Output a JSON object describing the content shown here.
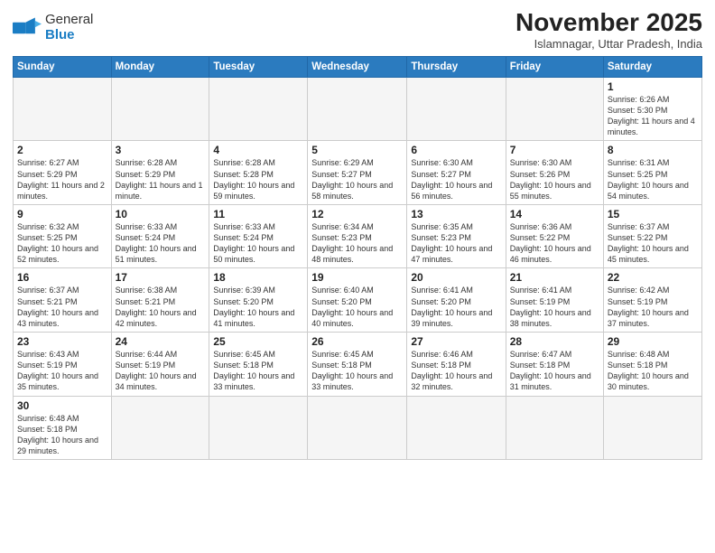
{
  "header": {
    "logo": {
      "general": "General",
      "blue": "Blue"
    },
    "month_year": "November 2025",
    "location": "Islamnagar, Uttar Pradesh, India"
  },
  "weekdays": [
    "Sunday",
    "Monday",
    "Tuesday",
    "Wednesday",
    "Thursday",
    "Friday",
    "Saturday"
  ],
  "weeks": [
    [
      {
        "day": "",
        "info": ""
      },
      {
        "day": "",
        "info": ""
      },
      {
        "day": "",
        "info": ""
      },
      {
        "day": "",
        "info": ""
      },
      {
        "day": "",
        "info": ""
      },
      {
        "day": "",
        "info": ""
      },
      {
        "day": "1",
        "info": "Sunrise: 6:26 AM\nSunset: 5:30 PM\nDaylight: 11 hours and 4 minutes."
      }
    ],
    [
      {
        "day": "2",
        "info": "Sunrise: 6:27 AM\nSunset: 5:29 PM\nDaylight: 11 hours and 2 minutes."
      },
      {
        "day": "3",
        "info": "Sunrise: 6:28 AM\nSunset: 5:29 PM\nDaylight: 11 hours and 1 minute."
      },
      {
        "day": "4",
        "info": "Sunrise: 6:28 AM\nSunset: 5:28 PM\nDaylight: 10 hours and 59 minutes."
      },
      {
        "day": "5",
        "info": "Sunrise: 6:29 AM\nSunset: 5:27 PM\nDaylight: 10 hours and 58 minutes."
      },
      {
        "day": "6",
        "info": "Sunrise: 6:30 AM\nSunset: 5:27 PM\nDaylight: 10 hours and 56 minutes."
      },
      {
        "day": "7",
        "info": "Sunrise: 6:30 AM\nSunset: 5:26 PM\nDaylight: 10 hours and 55 minutes."
      },
      {
        "day": "8",
        "info": "Sunrise: 6:31 AM\nSunset: 5:25 PM\nDaylight: 10 hours and 54 minutes."
      }
    ],
    [
      {
        "day": "9",
        "info": "Sunrise: 6:32 AM\nSunset: 5:25 PM\nDaylight: 10 hours and 52 minutes."
      },
      {
        "day": "10",
        "info": "Sunrise: 6:33 AM\nSunset: 5:24 PM\nDaylight: 10 hours and 51 minutes."
      },
      {
        "day": "11",
        "info": "Sunrise: 6:33 AM\nSunset: 5:24 PM\nDaylight: 10 hours and 50 minutes."
      },
      {
        "day": "12",
        "info": "Sunrise: 6:34 AM\nSunset: 5:23 PM\nDaylight: 10 hours and 48 minutes."
      },
      {
        "day": "13",
        "info": "Sunrise: 6:35 AM\nSunset: 5:23 PM\nDaylight: 10 hours and 47 minutes."
      },
      {
        "day": "14",
        "info": "Sunrise: 6:36 AM\nSunset: 5:22 PM\nDaylight: 10 hours and 46 minutes."
      },
      {
        "day": "15",
        "info": "Sunrise: 6:37 AM\nSunset: 5:22 PM\nDaylight: 10 hours and 45 minutes."
      }
    ],
    [
      {
        "day": "16",
        "info": "Sunrise: 6:37 AM\nSunset: 5:21 PM\nDaylight: 10 hours and 43 minutes."
      },
      {
        "day": "17",
        "info": "Sunrise: 6:38 AM\nSunset: 5:21 PM\nDaylight: 10 hours and 42 minutes."
      },
      {
        "day": "18",
        "info": "Sunrise: 6:39 AM\nSunset: 5:20 PM\nDaylight: 10 hours and 41 minutes."
      },
      {
        "day": "19",
        "info": "Sunrise: 6:40 AM\nSunset: 5:20 PM\nDaylight: 10 hours and 40 minutes."
      },
      {
        "day": "20",
        "info": "Sunrise: 6:41 AM\nSunset: 5:20 PM\nDaylight: 10 hours and 39 minutes."
      },
      {
        "day": "21",
        "info": "Sunrise: 6:41 AM\nSunset: 5:19 PM\nDaylight: 10 hours and 38 minutes."
      },
      {
        "day": "22",
        "info": "Sunrise: 6:42 AM\nSunset: 5:19 PM\nDaylight: 10 hours and 37 minutes."
      }
    ],
    [
      {
        "day": "23",
        "info": "Sunrise: 6:43 AM\nSunset: 5:19 PM\nDaylight: 10 hours and 35 minutes."
      },
      {
        "day": "24",
        "info": "Sunrise: 6:44 AM\nSunset: 5:19 PM\nDaylight: 10 hours and 34 minutes."
      },
      {
        "day": "25",
        "info": "Sunrise: 6:45 AM\nSunset: 5:18 PM\nDaylight: 10 hours and 33 minutes."
      },
      {
        "day": "26",
        "info": "Sunrise: 6:45 AM\nSunset: 5:18 PM\nDaylight: 10 hours and 33 minutes."
      },
      {
        "day": "27",
        "info": "Sunrise: 6:46 AM\nSunset: 5:18 PM\nDaylight: 10 hours and 32 minutes."
      },
      {
        "day": "28",
        "info": "Sunrise: 6:47 AM\nSunset: 5:18 PM\nDaylight: 10 hours and 31 minutes."
      },
      {
        "day": "29",
        "info": "Sunrise: 6:48 AM\nSunset: 5:18 PM\nDaylight: 10 hours and 30 minutes."
      }
    ],
    [
      {
        "day": "30",
        "info": "Sunrise: 6:48 AM\nSunset: 5:18 PM\nDaylight: 10 hours and 29 minutes."
      },
      {
        "day": "",
        "info": ""
      },
      {
        "day": "",
        "info": ""
      },
      {
        "day": "",
        "info": ""
      },
      {
        "day": "",
        "info": ""
      },
      {
        "day": "",
        "info": ""
      },
      {
        "day": "",
        "info": ""
      }
    ]
  ]
}
